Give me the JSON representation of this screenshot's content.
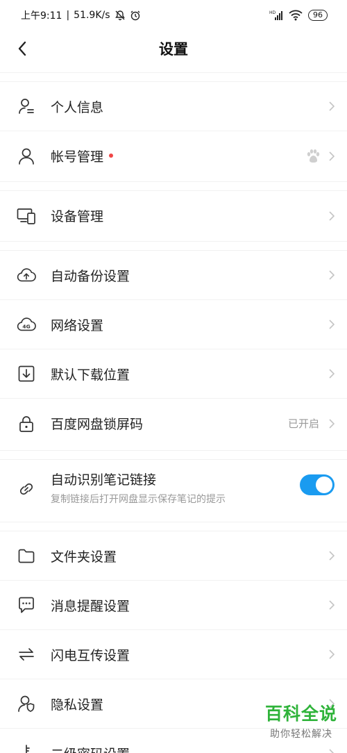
{
  "status": {
    "time": "上午9:11",
    "speed": "51.9K/s",
    "network": "HD",
    "battery": "96"
  },
  "header": {
    "title": "设置"
  },
  "groups": {
    "g1": [
      {
        "label": "个人信息",
        "icon": "user-info-icon"
      },
      {
        "label": "帐号管理",
        "icon": "user-icon",
        "badge": "red-dot",
        "right_icon": "baidu-paw-icon"
      }
    ],
    "g2": [
      {
        "label": "设备管理",
        "icon": "devices-icon"
      }
    ],
    "g3": [
      {
        "label": "自动备份设置",
        "icon": "cloud-upload-icon"
      },
      {
        "label": "网络设置",
        "icon": "cloud-4g-icon"
      },
      {
        "label": "默认下载位置",
        "icon": "download-icon"
      },
      {
        "label": "百度网盘锁屏码",
        "icon": "lock-icon",
        "right_text": "已开启"
      }
    ],
    "g4": [
      {
        "label": "自动识别笔记链接",
        "sub": "复制链接后打开网盘显示保存笔记的提示",
        "icon": "link-icon",
        "toggle_on": true
      }
    ],
    "g5": [
      {
        "label": "文件夹设置",
        "icon": "folder-icon"
      },
      {
        "label": "消息提醒设置",
        "icon": "message-icon"
      },
      {
        "label": "闪电互传设置",
        "icon": "transfer-icon"
      },
      {
        "label": "隐私设置",
        "icon": "privacy-icon"
      },
      {
        "label": "二级密码设置",
        "icon": "key-icon"
      }
    ]
  },
  "colors": {
    "accent": "#1a9bf0",
    "badge": "#f04646",
    "watermark": "#2fb33a"
  },
  "watermark": {
    "title": "百科全说",
    "subtitle": "助你轻松解决"
  }
}
